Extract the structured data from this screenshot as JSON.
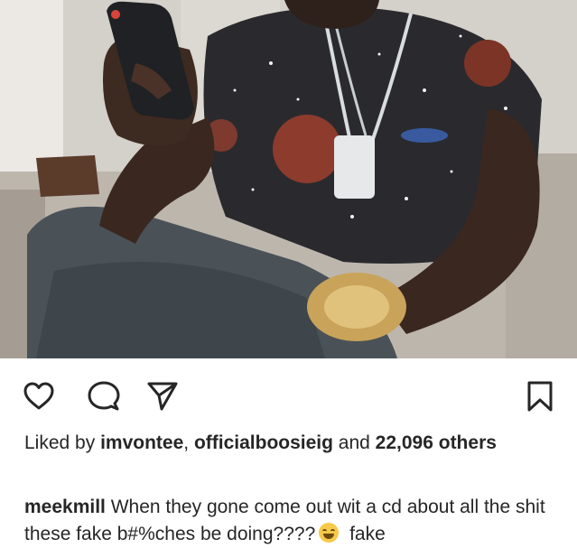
{
  "post": {
    "image_alt": "photo",
    "likes": {
      "prefix": "Liked by ",
      "user1": "imvontee",
      "sep": ", ",
      "user2": "officialboosieig",
      "and_label": " and ",
      "count": "22,096",
      "suffix": " others"
    },
    "caption": {
      "username": "meekmill",
      "text": " When they gone come out wit a cd about all the shit these fake b#%ches be doing????",
      "emoji": "face-with-tears-of-joy-emoji",
      "tail": " fake"
    }
  },
  "icons": {
    "like": "heart-icon",
    "comment": "comment-icon",
    "share": "direct-share-icon",
    "save": "bookmark-icon"
  },
  "colors": {
    "text": "#262626",
    "icon": "#262626"
  }
}
